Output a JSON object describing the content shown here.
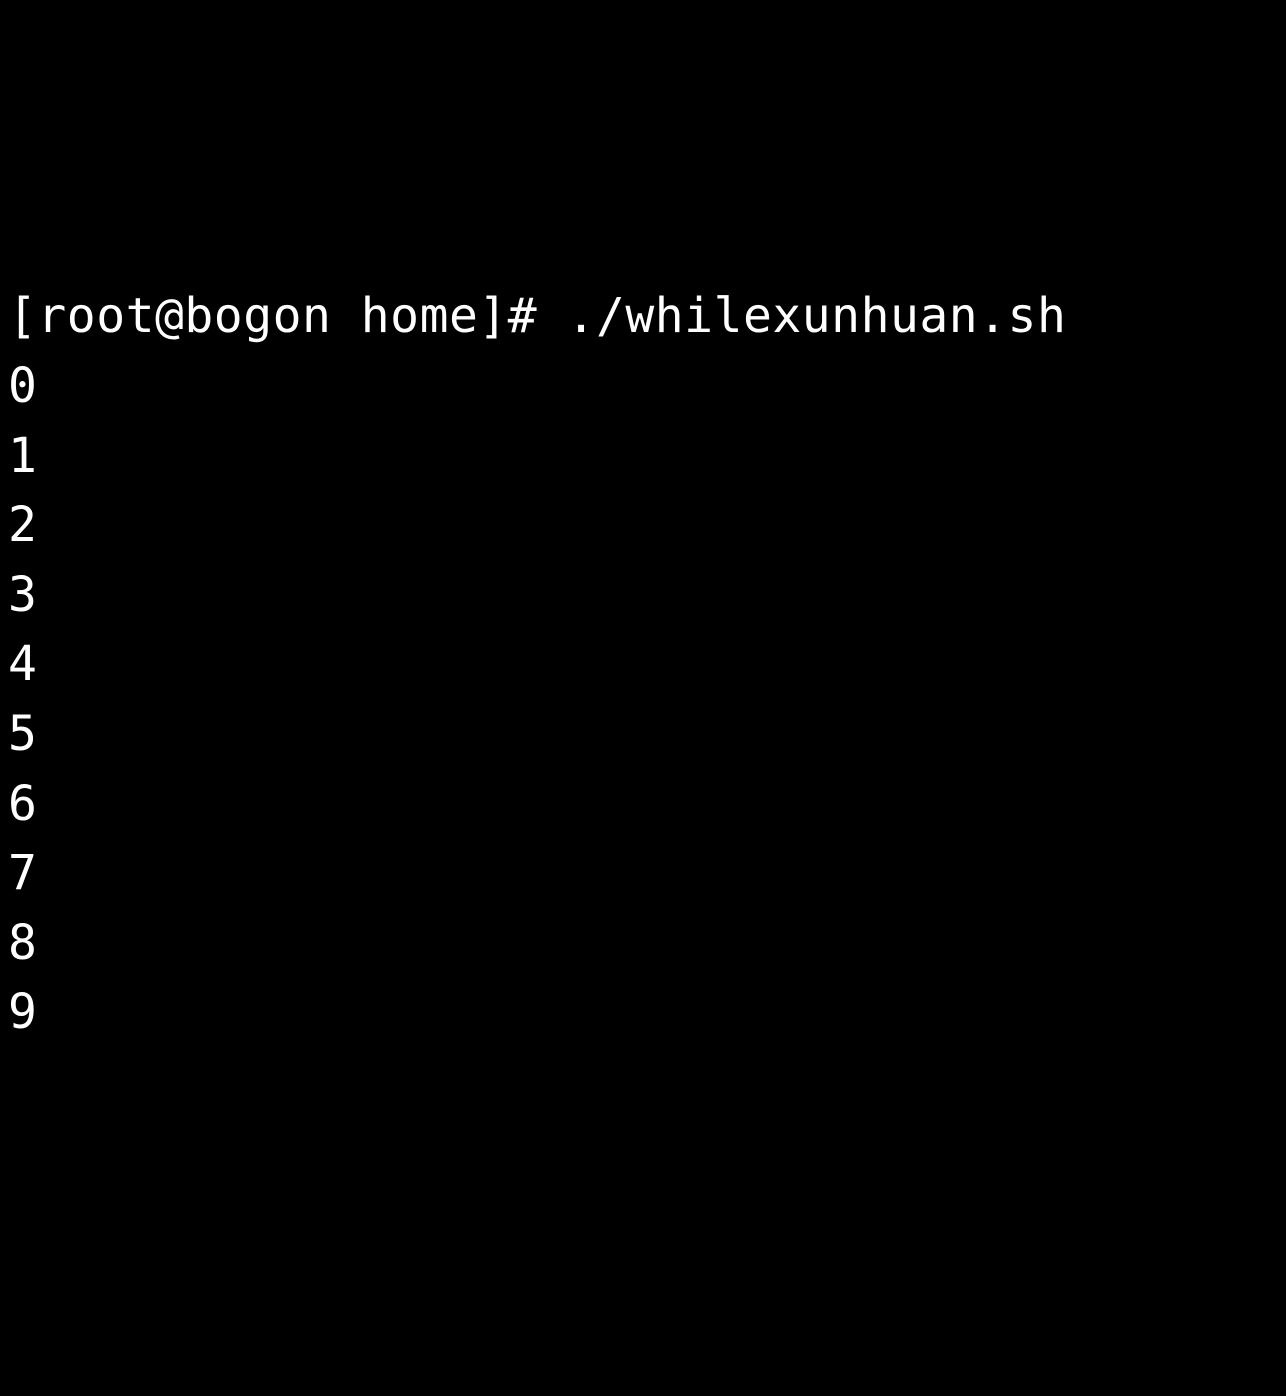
{
  "terminal": {
    "prompt_prefix": "[root@bogon home]# ",
    "command": "./whilexunhuan.sh",
    "output_lines": [
      "0",
      "1",
      "2",
      "3",
      "4",
      "5",
      "6",
      "7",
      "8",
      "9"
    ]
  }
}
